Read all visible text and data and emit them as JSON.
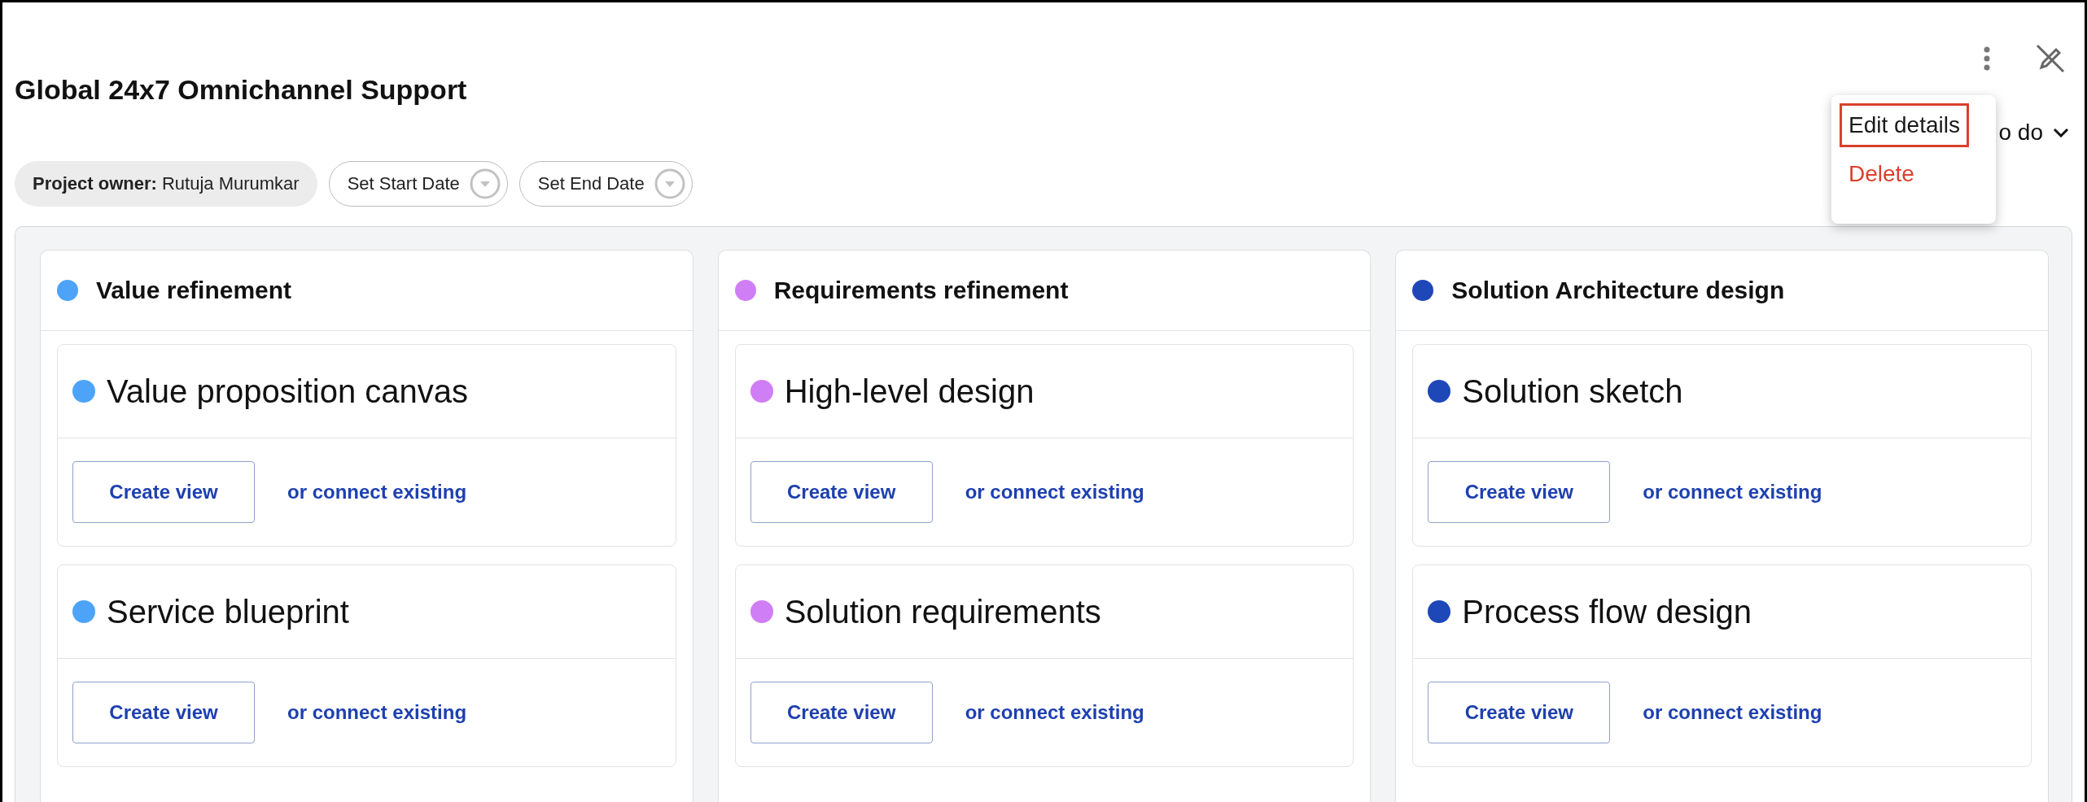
{
  "project": {
    "title": "Global 24x7 Omnichannel Support",
    "owner_label": "Project owner:",
    "owner_name": "Rutuja Murumkar",
    "start_date": "Set Start Date",
    "end_date": "Set End Date",
    "status": "o do"
  },
  "menu": {
    "items": [
      {
        "label": "Edit details",
        "kind": "normal",
        "selected": true
      },
      {
        "label": "Delete",
        "kind": "danger",
        "selected": false
      }
    ]
  },
  "columns": [
    {
      "title": "Value refinement",
      "color": "#4da3f8",
      "cards": [
        {
          "title": "Value proposition canvas",
          "color": "#4da3f8",
          "button": "Create view",
          "link": "or connect existing"
        },
        {
          "title": "Service blueprint",
          "color": "#4da3f8",
          "button": "Create view",
          "link": "or connect existing"
        }
      ]
    },
    {
      "title": "Requirements refinement",
      "color": "#cf7ef5",
      "cards": [
        {
          "title": "High-level design",
          "color": "#cf7ef5",
          "button": "Create view",
          "link": "or connect existing"
        },
        {
          "title": "Solution requirements",
          "color": "#cf7ef5",
          "button": "Create view",
          "link": "or connect existing"
        }
      ]
    },
    {
      "title": "Solution Architecture design",
      "color": "#1e47b8",
      "cards": [
        {
          "title": "Solution sketch",
          "color": "#1e47b8",
          "button": "Create view",
          "link": "or connect existing"
        },
        {
          "title": "Process flow design",
          "color": "#1e47b8",
          "button": "Create view",
          "link": "or connect existing"
        }
      ]
    }
  ]
}
